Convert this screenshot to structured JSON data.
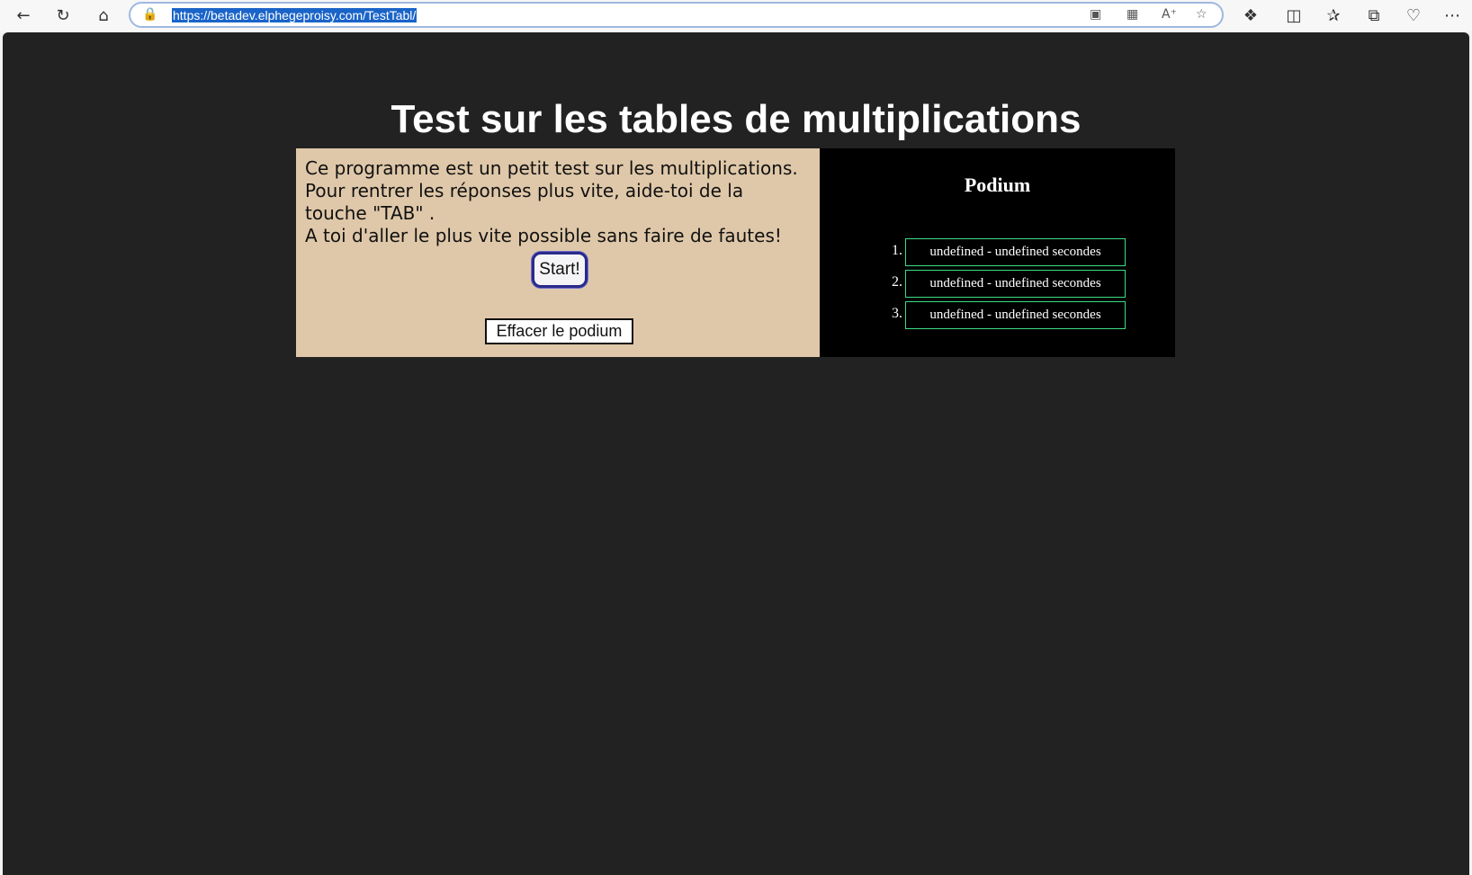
{
  "browser": {
    "url": "https://betadev.elphegeproisy.com/TestTabl/",
    "icons": {
      "back": "arrow-left-icon",
      "reload": "reload-icon",
      "home": "home-icon",
      "lock": "lock-icon",
      "app_available": "app-icon",
      "qr_code": "qr-code-icon",
      "read_aloud": "read-aloud-icon",
      "favorite": "star-icon",
      "extensions": "puzzle-icon",
      "split_screen": "split-screen-icon",
      "favorites_list": "favorites-icon",
      "collections": "collections-icon",
      "browser_essentials": "heart-pulse-icon",
      "more": "more-icon"
    }
  },
  "page": {
    "title": "Test sur les tables de multiplications",
    "intro_lines": [
      "Ce programme est un petit test sur les multiplications.",
      "Pour rentrer les réponses plus vite, aide-toi de la touche \"TAB\" .",
      "A toi d'aller le plus vite possible sans faire de fautes!"
    ],
    "start_label": "Start!",
    "clear_label": "Effacer le podium",
    "podium": {
      "title": "Podium",
      "entries": [
        {
          "rank": "1.",
          "text": "undefined - undefined secondes"
        },
        {
          "rank": "2.",
          "text": "undefined - undefined secondes"
        },
        {
          "rank": "3.",
          "text": "undefined - undefined secondes"
        }
      ]
    }
  },
  "colors": {
    "page_background": "#222222",
    "intro_panel": "#dfc8a9",
    "podium_panel": "#000000",
    "podium_border": "#3ddc84",
    "url_highlight": "#1a64c8"
  }
}
